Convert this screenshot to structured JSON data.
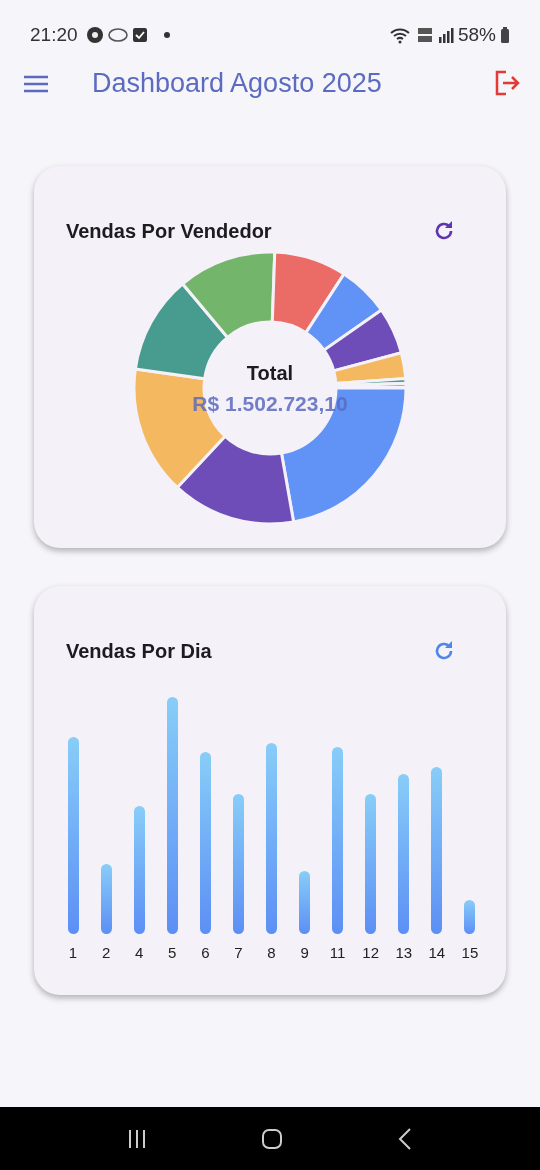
{
  "status_bar": {
    "time": "21:20",
    "battery": "58%"
  },
  "app_bar": {
    "title": "Dashboard Agosto 2025"
  },
  "cards": [
    {
      "title": "Vendas Por Vendedor",
      "kind": "donut",
      "center_label": "Total",
      "center_value": "R$ 1.502.723,10"
    },
    {
      "title": "Vendas Por Dia",
      "kind": "bars",
      "day_labels": [
        "1",
        "2",
        "4",
        "5",
        "6",
        "7",
        "8",
        "9",
        "11",
        "12",
        "13",
        "14",
        "15"
      ]
    }
  ]
}
